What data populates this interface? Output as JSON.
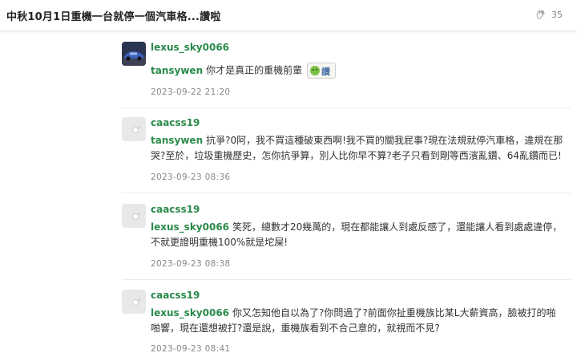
{
  "header": {
    "title": "中秋10月1日重機一台就停一個汽車格...讚啦",
    "like_icon": "clap-icon",
    "like_count": "35"
  },
  "replies": [
    {
      "avatar": "car-photo-avatar",
      "username": "lexus_sky0066",
      "mention": "tansywen",
      "text": "你才是真正的重機前輩",
      "sticker": "讚",
      "timestamp": "2023-09-22 21:20"
    },
    {
      "avatar": "default-avatar",
      "username": "caacss19",
      "mention": "tansywen",
      "text": "抗爭?0阿，我不買這種破東西啊!我不買的關我屁事?現在法規就停汽車格，違規在那哭?至於，垃圾重機歷史，怎你抗爭算，別人比你早不算?老子只看到剛等西濱亂鑽、64亂鑽而已!",
      "timestamp": "2023-09-23 08:36"
    },
    {
      "avatar": "default-avatar",
      "username": "caacss19",
      "mention": "lexus_sky0066",
      "text": "笑死，總數才20幾萬的，現在都能讓人到處反感了，還能讓人看到處處違停，不就更證明重機100%就是坨屎!",
      "timestamp": "2023-09-23 08:38"
    },
    {
      "avatar": "default-avatar",
      "username": "caacss19",
      "mention": "lexus_sky0066",
      "text": "你又怎知他自以為了?你問過了?前面你扯重機族比某L大薪資高，臉被打的啪啪響，現在還想被打?還是說，重機族看到不合己意的，就視而不見?",
      "timestamp": "2023-09-23 08:41"
    }
  ],
  "colors": {
    "username": "#2a8a4a",
    "text": "#333333",
    "timestamp": "#888888",
    "separator": "#ebebeb"
  }
}
